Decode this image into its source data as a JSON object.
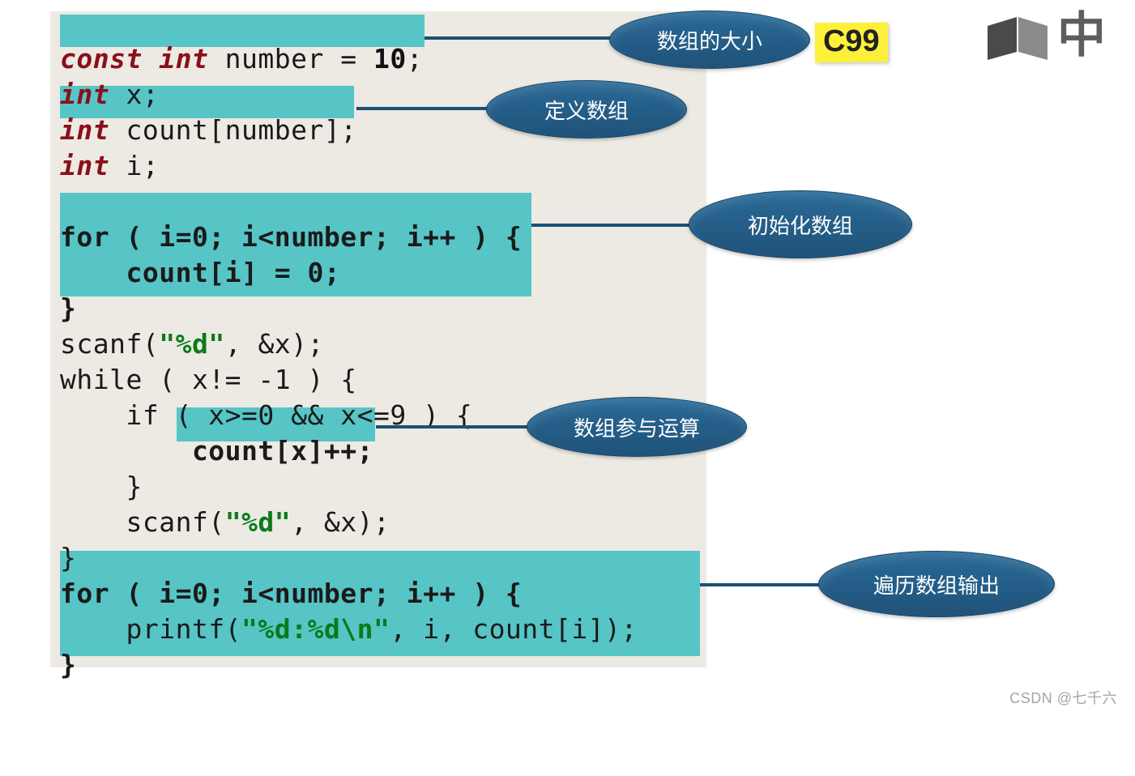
{
  "annotations": {
    "array_size": "数组的大小",
    "define_array": "定义数组",
    "init_array": "初始化数组",
    "compute": "数组参与运算",
    "output": "遍历数组输出"
  },
  "badge": "C99",
  "corner_glyph": "中",
  "watermark": "CSDN @七千六",
  "code": {
    "l1a": "const int",
    "l1b": " number = ",
    "l1c": "10",
    "l1d": ";",
    "l2a": "int",
    "l2b": " x;",
    "l3a": "int",
    "l3b": " count[number];",
    "l4a": "int",
    "l4b": " i;",
    "blank1": "",
    "l6": "for ( i=0; i<number; i++ ) {",
    "l7": "    count[i] = 0;",
    "l8": "}",
    "l9a": "scanf(",
    "l9b": "\"%d\"",
    "l9c": ", &x);",
    "l10": "while ( x!= -1 ) {",
    "l11": "    if ( x>=0 && x<=9 ) {",
    "l12": "        count[x]++;",
    "l13": "    }",
    "l14a": "    scanf(",
    "l14b": "\"%d\"",
    "l14c": ", &x);",
    "l15": "}",
    "l16": "for ( i=0; i<number; i++ ) {",
    "l17a": "    printf(",
    "l17b": "\"%d:%d\\n\"",
    "l17c": ", i, count[i]);",
    "l18": "}"
  }
}
